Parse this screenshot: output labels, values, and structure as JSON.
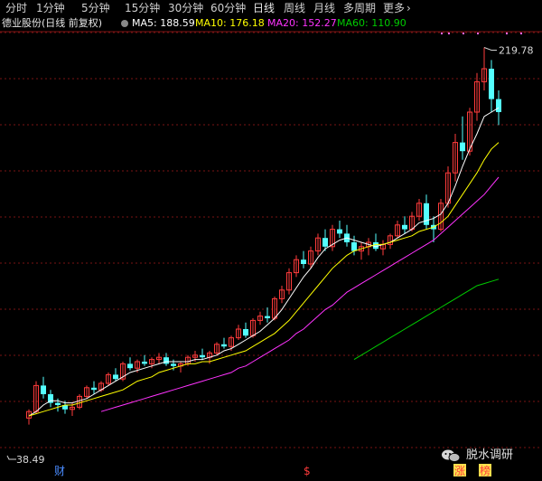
{
  "toolbar": {
    "tabs": [
      {
        "label": "分时",
        "x": 6
      },
      {
        "label": "1分钟",
        "x": 40
      },
      {
        "label": "5分钟",
        "x": 90
      },
      {
        "label": "15分钟",
        "x": 138
      },
      {
        "label": "30分钟",
        "x": 186
      },
      {
        "label": "60分钟",
        "x": 233
      },
      {
        "label": "日线",
        "x": 280,
        "active": true
      },
      {
        "label": "周线",
        "x": 314
      },
      {
        "label": "月线",
        "x": 347
      },
      {
        "label": "多周期",
        "x": 380
      },
      {
        "label": "更多",
        "x": 424
      }
    ]
  },
  "legend": {
    "title": "德业股份(日线 前复权)",
    "ma5": "MA5: 188.59",
    "ma10": "MA10: 176.18",
    "ma20": "MA20: 152.27",
    "ma60": "MA60: 110.90",
    "colors": {
      "ma5": "#ffffff",
      "ma10": "#ffff00",
      "ma20": "#ff33ff",
      "ma60": "#00cc00"
    }
  },
  "chart_data": {
    "type": "candlestick",
    "y_range": [
      38.49,
      219.78
    ],
    "high_label": "219.78",
    "low_label": "38.49",
    "markers": [
      {
        "text": "财",
        "color": "#4a8cff"
      },
      {
        "text": "$",
        "color": "#ff3b3b"
      },
      {
        "text": "涨",
        "color": "#ff3b3b",
        "bg": "#ffe04d"
      },
      {
        "text": "榜",
        "color": "#ff3b3b",
        "bg": "#ffe04d"
      }
    ],
    "candles": [
      [
        49,
        53,
        46,
        52
      ],
      [
        52,
        66,
        51,
        64
      ],
      [
        64,
        68,
        58,
        60
      ],
      [
        60,
        62,
        54,
        56
      ],
      [
        56,
        58,
        52,
        55
      ],
      [
        55,
        57,
        51,
        53
      ],
      [
        53,
        56,
        50,
        54
      ],
      [
        54,
        60,
        53,
        59
      ],
      [
        59,
        64,
        58,
        63
      ],
      [
        63,
        66,
        60,
        62
      ],
      [
        62,
        66,
        61,
        65
      ],
      [
        65,
        70,
        64,
        69
      ],
      [
        69,
        72,
        66,
        67
      ],
      [
        67,
        75,
        66,
        74
      ],
      [
        74,
        77,
        71,
        72
      ],
      [
        72,
        76,
        70,
        75
      ],
      [
        75,
        78,
        73,
        74
      ],
      [
        74,
        77,
        72,
        76
      ],
      [
        76,
        79,
        74,
        77
      ],
      [
        77,
        79,
        73,
        74
      ],
      [
        74,
        76,
        71,
        73
      ],
      [
        73,
        75,
        70,
        74
      ],
      [
        74,
        78,
        73,
        77
      ],
      [
        77,
        80,
        75,
        78
      ],
      [
        78,
        81,
        76,
        77
      ],
      [
        77,
        80,
        74,
        79
      ],
      [
        79,
        84,
        78,
        83
      ],
      [
        83,
        86,
        81,
        82
      ],
      [
        82,
        87,
        80,
        86
      ],
      [
        86,
        92,
        85,
        90
      ],
      [
        90,
        93,
        86,
        87
      ],
      [
        87,
        95,
        86,
        94
      ],
      [
        94,
        98,
        92,
        96
      ],
      [
        96,
        100,
        93,
        95
      ],
      [
        95,
        105,
        94,
        104
      ],
      [
        104,
        110,
        102,
        108
      ],
      [
        108,
        118,
        106,
        116
      ],
      [
        116,
        124,
        114,
        122
      ],
      [
        122,
        126,
        118,
        120
      ],
      [
        120,
        128,
        118,
        126
      ],
      [
        126,
        134,
        124,
        132
      ],
      [
        132,
        136,
        126,
        128
      ],
      [
        128,
        138,
        126,
        136
      ],
      [
        136,
        140,
        132,
        134
      ],
      [
        134,
        138,
        128,
        130
      ],
      [
        130,
        133,
        124,
        126
      ],
      [
        126,
        130,
        122,
        128
      ],
      [
        128,
        132,
        124,
        130
      ],
      [
        130,
        134,
        126,
        127
      ],
      [
        127,
        131,
        124,
        129
      ],
      [
        129,
        134,
        127,
        133
      ],
      [
        133,
        140,
        132,
        138
      ],
      [
        138,
        142,
        134,
        136
      ],
      [
        136,
        144,
        135,
        142
      ],
      [
        142,
        150,
        140,
        148
      ],
      [
        148,
        152,
        136,
        138
      ],
      [
        138,
        142,
        130,
        136
      ],
      [
        136,
        150,
        135,
        148
      ],
      [
        148,
        165,
        146,
        162
      ],
      [
        162,
        180,
        158,
        176
      ],
      [
        176,
        188,
        168,
        172
      ],
      [
        172,
        192,
        170,
        190
      ],
      [
        190,
        208,
        186,
        204
      ],
      [
        204,
        219.78,
        200,
        210
      ],
      [
        210,
        214,
        190,
        196
      ],
      [
        196,
        200,
        184,
        190
      ]
    ],
    "ma5": [
      50,
      52,
      55,
      57,
      57,
      56,
      56,
      57,
      58,
      60,
      62,
      64,
      66,
      68,
      70,
      71,
      72,
      73,
      74,
      75,
      75,
      75,
      75,
      76,
      76,
      77,
      78,
      80,
      81,
      83,
      85,
      87,
      89,
      92,
      95,
      99,
      104,
      109,
      114,
      118,
      123,
      127,
      129,
      131,
      132,
      131,
      130,
      129,
      128,
      129,
      130,
      132,
      134,
      136,
      139,
      140,
      141,
      143,
      148,
      156,
      165,
      173,
      180,
      188,
      190,
      192
    ],
    "ma10": [
      50,
      51,
      52,
      53,
      54,
      55,
      55,
      56,
      57,
      58,
      59,
      60,
      61,
      62,
      64,
      66,
      67,
      68,
      70,
      71,
      72,
      73,
      74,
      74,
      75,
      75,
      76,
      77,
      78,
      79,
      80,
      82,
      84,
      86,
      88,
      91,
      94,
      98,
      102,
      106,
      110,
      114,
      118,
      121,
      124,
      126,
      127,
      128,
      129,
      129,
      130,
      131,
      132,
      133,
      135,
      136,
      137,
      139,
      142,
      147,
      152,
      157,
      162,
      168,
      173,
      176
    ],
    "ma20": {
      "start_index": 10,
      "values": [
        52,
        53,
        54,
        55,
        56,
        57,
        58,
        59,
        60,
        61,
        62,
        63,
        64,
        65,
        66,
        67,
        68,
        69,
        70,
        72,
        73,
        75,
        77,
        79,
        81,
        83,
        85,
        88,
        90,
        93,
        96,
        99,
        101,
        104,
        107,
        109,
        111,
        113,
        115,
        117,
        119,
        121,
        123,
        125,
        127,
        129,
        131,
        134,
        137,
        140,
        143,
        146,
        149,
        152,
        156,
        160
      ]
    },
    "ma60": {
      "start_index": 45,
      "values": [
        76,
        78,
        80,
        82,
        84,
        86,
        88,
        90,
        92,
        94,
        96,
        98,
        100,
        102,
        104,
        106,
        108,
        110,
        111,
        112,
        113
      ]
    }
  },
  "watermark": {
    "text": "脱水调研",
    "icon": "wechat-icon"
  }
}
